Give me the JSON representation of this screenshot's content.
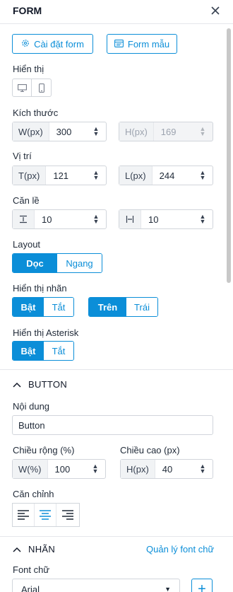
{
  "header": {
    "title": "FORM"
  },
  "top_buttons": {
    "settings": "Cài đặt form",
    "template": "Form mẫu"
  },
  "display": {
    "label": "Hiển thị"
  },
  "size": {
    "label": "Kích thước",
    "width_prefix": "W(px)",
    "width_value": "300",
    "height_prefix": "H(px)",
    "height_value": "169"
  },
  "position": {
    "label": "Vị trí",
    "top_prefix": "T(px)",
    "top_value": "121",
    "left_prefix": "L(px)",
    "left_value": "244"
  },
  "margin": {
    "label": "Căn lề",
    "vertical_value": "10",
    "horizontal_value": "10"
  },
  "layout": {
    "label": "Layout",
    "options": [
      "Dọc",
      "Ngang"
    ],
    "selected": "Dọc"
  },
  "show_label": {
    "label": "Hiển thị nhãn",
    "toggle": [
      "Bật",
      "Tắt"
    ],
    "toggle_selected": "Bật",
    "position": [
      "Trên",
      "Trái"
    ],
    "position_selected": "Trên"
  },
  "show_asterisk": {
    "label": "Hiển thị Asterisk",
    "toggle": [
      "Bật",
      "Tắt"
    ],
    "toggle_selected": "Bật"
  },
  "button_section": {
    "title": "BUTTON",
    "content_label": "Nội dung",
    "content_value": "Button",
    "width_label": "Chiều rộng (%)",
    "width_prefix": "W(%)",
    "width_value": "100",
    "height_label": "Chiều cao (px)",
    "height_prefix": "H(px)",
    "height_value": "40",
    "align_label": "Căn chỉnh",
    "align_selected": "center"
  },
  "label_section": {
    "title": "NHÃN",
    "manage_fonts_link": "Quản lý font chữ",
    "font_label": "Font chữ",
    "font_value": "Arial"
  },
  "colors": {
    "accent": "#0b8ed8",
    "border": "#d1d5db"
  }
}
